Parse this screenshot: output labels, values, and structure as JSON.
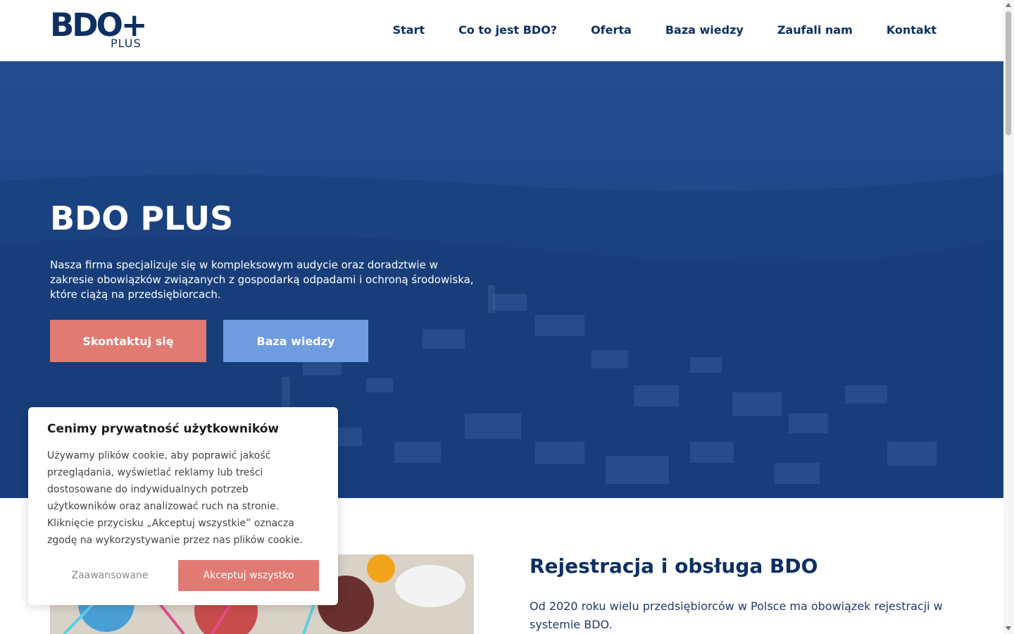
{
  "header": {
    "logo": {
      "main": "BDO+",
      "sub": "PLUS"
    },
    "nav": [
      {
        "label": "Start"
      },
      {
        "label": "Co to jest BDO?"
      },
      {
        "label": "Oferta"
      },
      {
        "label": "Baza wiedzy"
      },
      {
        "label": "Zaufali nam"
      },
      {
        "label": "Kontakt"
      }
    ]
  },
  "hero": {
    "title": "BDO PLUS",
    "description": "Nasza firma specjalizuje się w kompleksowym audycie oraz doradztwie w zakresie obowiązków związanych z gospodarką odpadami i ochroną środowiska, które ciążą na przedsiębiorcach.",
    "buttons": {
      "contact": "Skontaktuj się",
      "knowledge_base": "Baza wiedzy"
    },
    "background": "aerial-town-photo"
  },
  "section": {
    "title": "Rejestracja i obsługa BDO",
    "text": "Od 2020 roku wielu przedsiębiorców w Polsce ma obowiązek rejestracji w systemie BDO.",
    "image": "plastic-waste-photo"
  },
  "cookie": {
    "title": "Cenimy prywatność użytkowników",
    "text": "Używamy plików cookie, aby poprawić jakość przeglądania, wyświetlać reklamy lub treści dostosowane do indywidualnych potrzeb użytkowników oraz analizować ruch na stronie. Kliknięcie przycisku „Akceptuj wszystkie” oznacza zgodę na wykorzystywanie przez nas plików cookie.",
    "advanced": "Zaawansowane",
    "accept": "Akceptuj wszystko"
  },
  "colors": {
    "brand_navy": "#0e2f63",
    "accent_coral": "#e07a72",
    "accent_blue": "#6f9be0",
    "hero_overlay": "#103a80"
  }
}
